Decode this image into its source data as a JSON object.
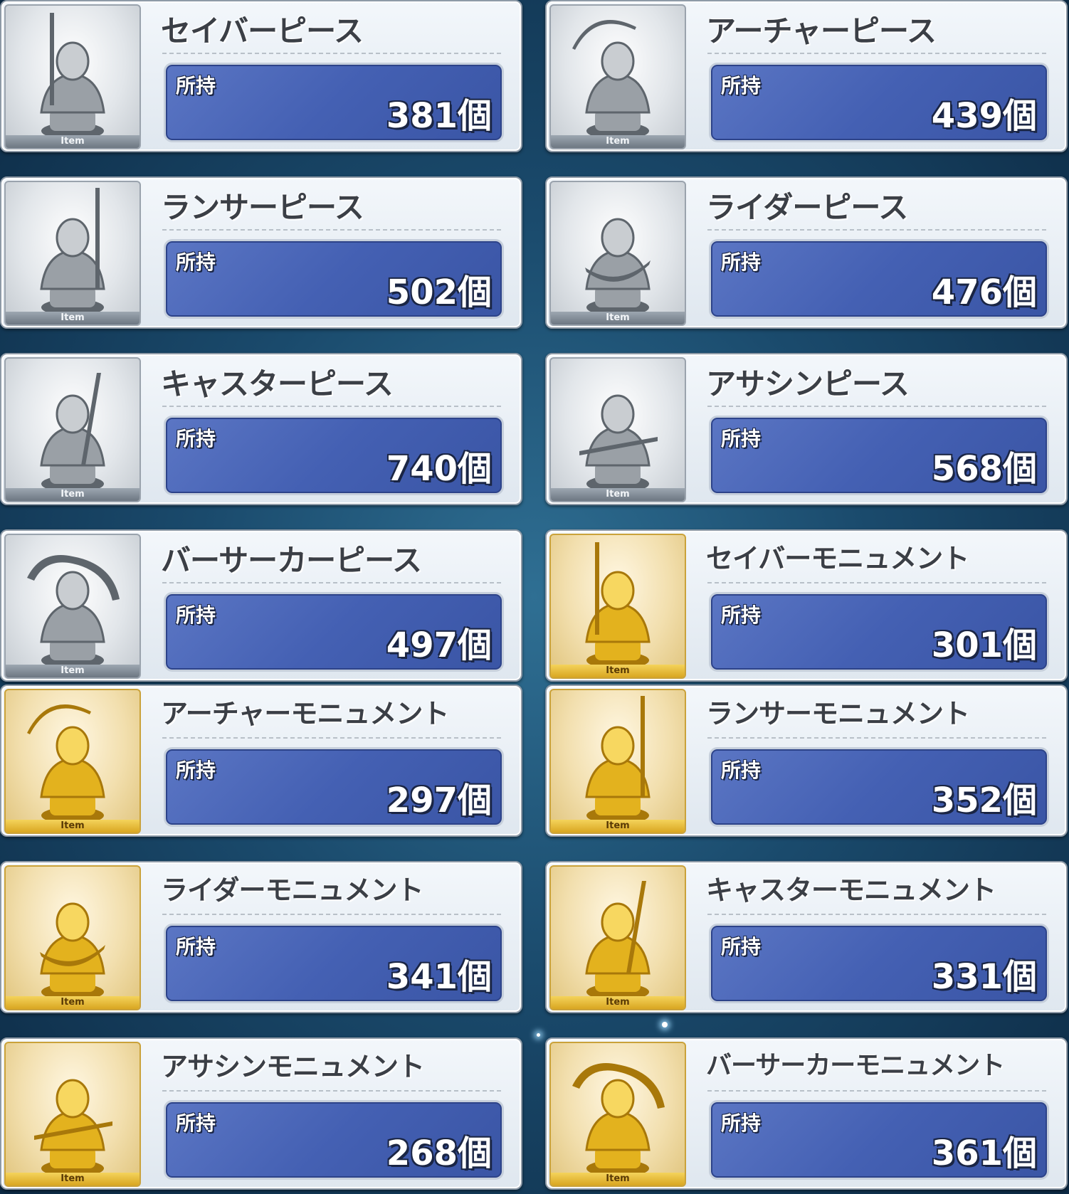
{
  "item_strip_label": "Item",
  "owned_label": "所持",
  "colors": {
    "silver_bg": "#dfe3e7",
    "gold_bg": "#f2dfae",
    "panel_blue": "#4460b3",
    "page_bg": "#1a4a6c"
  },
  "items": [
    {
      "name": "セイバーピース",
      "count": "381個",
      "tier": "silver",
      "icon": "saber-statue-icon"
    },
    {
      "name": "アーチャーピース",
      "count": "439個",
      "tier": "silver",
      "icon": "archer-statue-icon"
    },
    {
      "name": "ランサーピース",
      "count": "502個",
      "tier": "silver",
      "icon": "lancer-statue-icon"
    },
    {
      "name": "ライダーピース",
      "count": "476個",
      "tier": "silver",
      "icon": "rider-statue-icon"
    },
    {
      "name": "キャスターピース",
      "count": "740個",
      "tier": "silver",
      "icon": "caster-statue-icon"
    },
    {
      "name": "アサシンピース",
      "count": "568個",
      "tier": "silver",
      "icon": "assassin-statue-icon"
    },
    {
      "name": "バーサーカーピース",
      "count": "497個",
      "tier": "silver",
      "icon": "berserker-statue-icon"
    },
    {
      "name": "セイバーモニュメント",
      "count": "301個",
      "tier": "gold",
      "icon": "saber-statue-icon"
    },
    {
      "name": "アーチャーモニュメント",
      "count": "297個",
      "tier": "gold",
      "icon": "archer-statue-icon"
    },
    {
      "name": "ランサーモニュメント",
      "count": "352個",
      "tier": "gold",
      "icon": "lancer-statue-icon"
    },
    {
      "name": "ライダーモニュメント",
      "count": "341個",
      "tier": "gold",
      "icon": "rider-statue-icon"
    },
    {
      "name": "キャスターモニュメント",
      "count": "331個",
      "tier": "gold",
      "icon": "caster-statue-icon"
    },
    {
      "name": "アサシンモニュメント",
      "count": "268個",
      "tier": "gold",
      "icon": "assassin-statue-icon"
    },
    {
      "name": "バーサーカーモニュメント",
      "count": "361個",
      "tier": "gold",
      "icon": "berserker-statue-icon"
    }
  ]
}
